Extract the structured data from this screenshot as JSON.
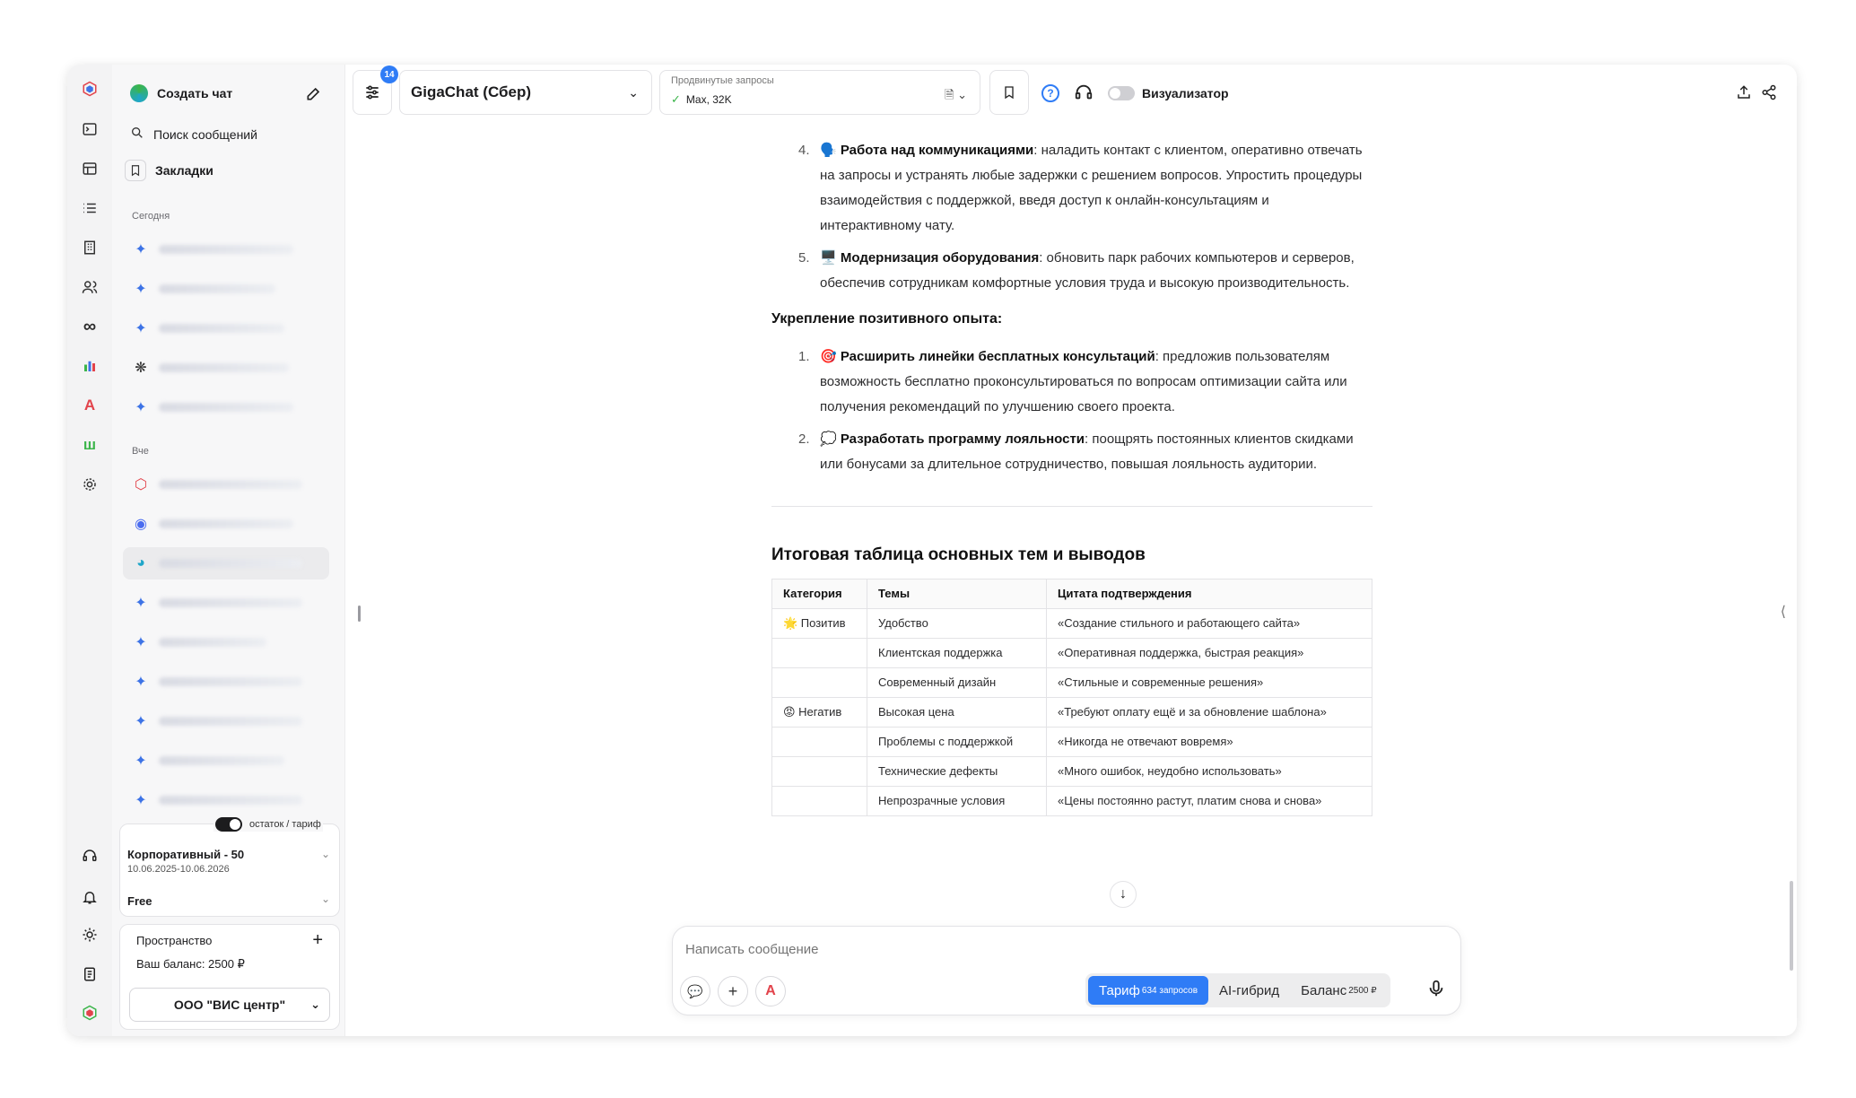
{
  "sidebar": {
    "create_chat": "Создать чат",
    "search": "Поиск сообщений",
    "bookmarks": "Закладки",
    "today": "Сегодня",
    "yesterday": "Вче",
    "plan_toggle_label": "остаток / тариф",
    "plan_name": "Корпоративный - 50",
    "plan_dates": "10.06.2025-10.06.2026",
    "plan_free": "Free",
    "space_title": "Пространство",
    "balance": "Ваш баланс: 2500 ₽",
    "org": "ООО \"ВИС центр\""
  },
  "topbar": {
    "filter_badge": "14",
    "model": "GigaChat (Сбер)",
    "advanced_label": "Продвинутые запросы",
    "advanced_value": "Max, 32K",
    "visualizer": "Визуализатор"
  },
  "content": {
    "items_a": [
      {
        "num": "4.",
        "emoji": "🗣️",
        "bold": "Работа над коммуникациями",
        "text": ": наладить контакт с клиентом, оперативно отвечать на запросы и устранять любые задержки с решением вопросов. Упростить процедуры взаимодействия с поддержкой, введя доступ к онлайн-консультациям и интерактивному чату."
      },
      {
        "num": "5.",
        "emoji": "🖥️",
        "bold": "Модернизация оборудования",
        "text": ": обновить парк рабочих компьютеров и серверов, обеспечив сотрудникам комфортные условия труда и высокую производительность."
      }
    ],
    "section2": "Укрепление позитивного опыта:",
    "items_b": [
      {
        "num": "1.",
        "emoji": "🎯",
        "bold": "Расширить линейки бесплатных консультаций",
        "text": ": предложив пользователям возможность бесплатно проконсультироваться по вопросам оптимизации сайта или получения рекомендаций по улучшению своего проекта."
      },
      {
        "num": "2.",
        "emoji": "💭",
        "bold": "Разработать программу лояльности",
        "text": ": поощрять постоянных клиентов скидками или бонусами за длительное сотрудничество, повышая лояльность аудитории."
      }
    ],
    "table_title": "Итоговая таблица основных тем и выводов",
    "table": {
      "headers": [
        "Категория",
        "Темы",
        "Цитата подтверждения"
      ],
      "rows": [
        [
          "🌟 Позитив",
          "Удобство",
          "«Создание стильного и работающего сайта»"
        ],
        [
          "",
          "Клиентская поддержка",
          "«Оперативная поддержка, быстрая реакция»"
        ],
        [
          "",
          "Современный дизайн",
          "«Стильные и современные решения»"
        ],
        [
          "😡 Негатив",
          "Высокая цена",
          "«Требуют оплату ещё и за обновление шаблона»"
        ],
        [
          "",
          "Проблемы с поддержкой",
          "«Никогда не отвечают вовремя»"
        ],
        [
          "",
          "Технические дефекты",
          "«Много ошибок, неудобно использовать»"
        ],
        [
          "",
          "Непрозрачные условия",
          "«Цены постоянно растут, платим снова и снова»"
        ]
      ]
    }
  },
  "composer": {
    "placeholder": "Написать сообщение",
    "tariff": "Тариф",
    "tariff_sup": "634 запросов",
    "hybrid": "AI-гибрид",
    "balance": "Баланс",
    "balance_sup": "2500 ₽"
  },
  "colors": {
    "accent": "#2f7cf6",
    "spark": "#3d73e6"
  }
}
